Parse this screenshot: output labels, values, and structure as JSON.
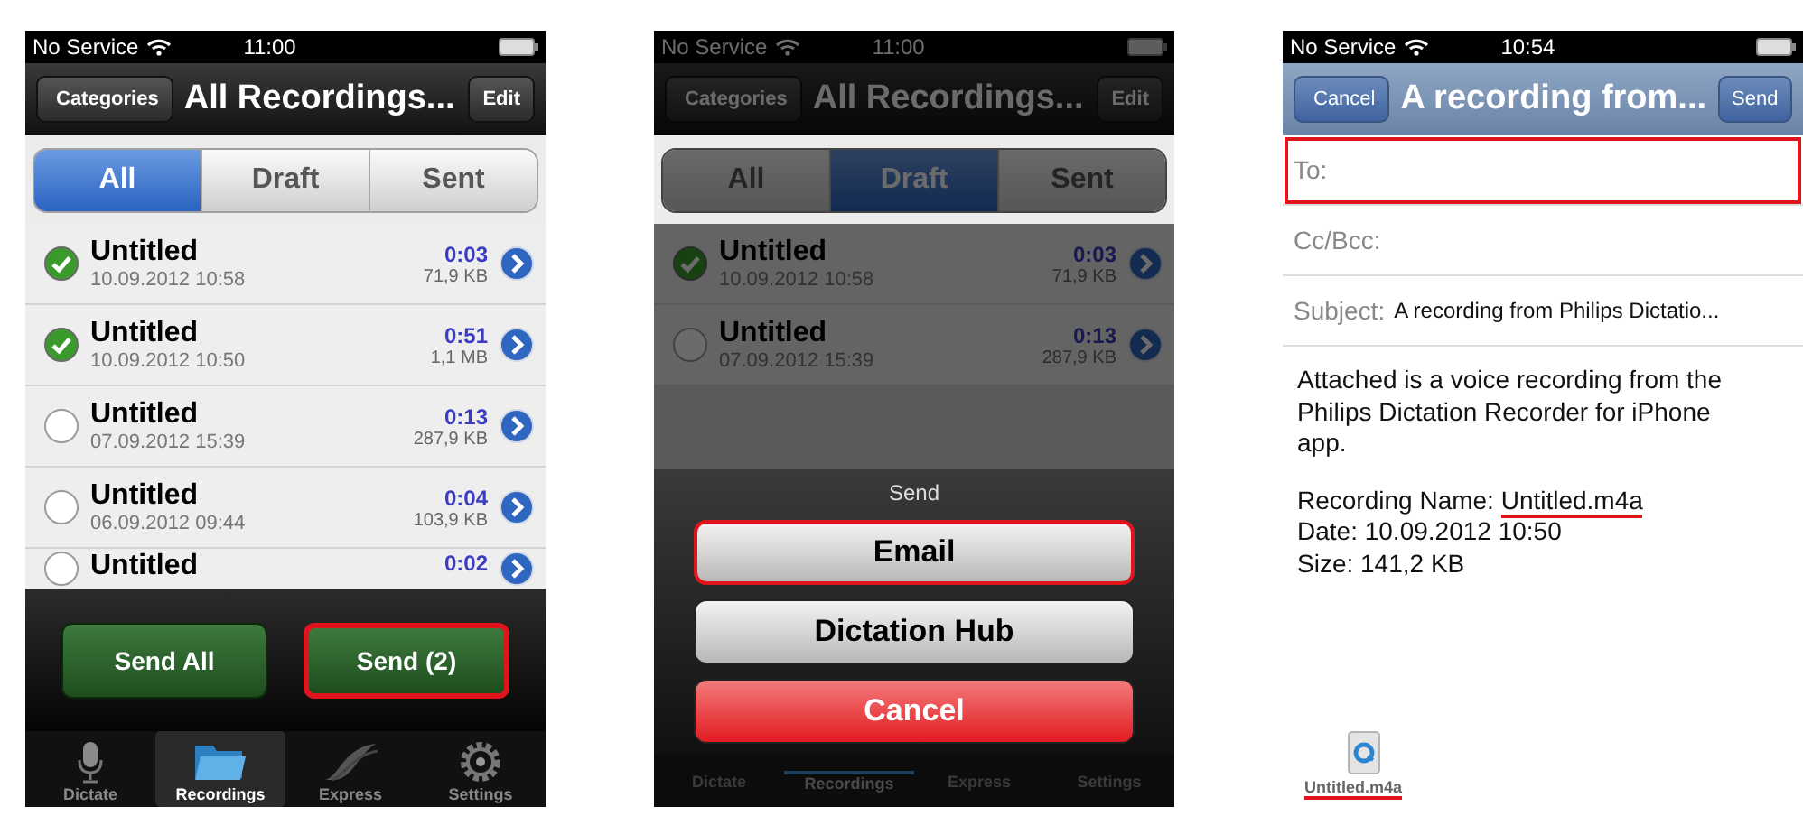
{
  "screens": [
    {
      "kind": "list",
      "dimmed": false,
      "status": {
        "carrier": "No Service",
        "time": "11:00"
      },
      "nav": {
        "back": "Categories",
        "title": "All Recordings...",
        "action": "Edit"
      },
      "segments": [
        {
          "label": "All",
          "selected": true
        },
        {
          "label": "Draft",
          "selected": false
        },
        {
          "label": "Sent",
          "selected": false
        }
      ],
      "rows": [
        {
          "name": "Untitled",
          "date": "10.09.2012 10:58",
          "duration": "0:03",
          "size": "71,9 KB",
          "checked": true
        },
        {
          "name": "Untitled",
          "date": "10.09.2012 10:50",
          "duration": "0:51",
          "size": "1,1 MB",
          "checked": true
        },
        {
          "name": "Untitled",
          "date": "07.09.2012 15:39",
          "duration": "0:13",
          "size": "287,9 KB",
          "checked": false
        },
        {
          "name": "Untitled",
          "date": "06.09.2012 09:44",
          "duration": "0:04",
          "size": "103,9 KB",
          "checked": false
        },
        {
          "name": "Untitled",
          "duration": "0:02",
          "checked": false
        }
      ],
      "toolbar": [
        {
          "label": "Send All",
          "highlighted": false
        },
        {
          "label": "Send (2)",
          "highlighted": true
        }
      ],
      "tabs": [
        {
          "label": "Dictate",
          "selected": false
        },
        {
          "label": "Recordings",
          "selected": true
        },
        {
          "label": "Express",
          "selected": false
        },
        {
          "label": "Settings",
          "selected": false
        }
      ]
    },
    {
      "kind": "list",
      "dimmed": true,
      "status": {
        "carrier": "No Service",
        "time": "11:00"
      },
      "nav": {
        "back": "Categories",
        "title": "All Recordings...",
        "action": "Edit"
      },
      "segments": [
        {
          "label": "All",
          "selected": false
        },
        {
          "label": "Draft",
          "selected": true
        },
        {
          "label": "Sent",
          "selected": false
        }
      ],
      "rows": [
        {
          "name": "Untitled",
          "date": "10.09.2012 10:58",
          "duration": "0:03",
          "size": "71,9 KB",
          "checked": true
        },
        {
          "name": "Untitled",
          "date": "07.09.2012 15:39",
          "duration": "0:13",
          "size": "287,9 KB",
          "checked": false
        }
      ],
      "sheet": {
        "title": "Send",
        "buttons": [
          {
            "label": "Email",
            "kind": "default",
            "highlighted": true
          },
          {
            "label": "Dictation Hub",
            "kind": "default",
            "highlighted": false
          },
          {
            "label": "Cancel",
            "kind": "destructive",
            "highlighted": false
          }
        ]
      },
      "tabs": [
        {
          "label": "Dictate",
          "selected": false
        },
        {
          "label": "Recordings",
          "selected": true
        },
        {
          "label": "Express",
          "selected": false
        },
        {
          "label": "Settings",
          "selected": false
        }
      ]
    },
    {
      "kind": "mail",
      "status": {
        "carrier": "No Service",
        "time": "10:54"
      },
      "nav": {
        "back": "Cancel",
        "title": "A recording from...",
        "action": "Send"
      },
      "fields": [
        {
          "label": "To:",
          "highlighted": true
        },
        {
          "label": "Cc/Bcc:",
          "highlighted": false
        },
        {
          "label": "Subject:",
          "value": "A recording from Philips Dictatio...",
          "highlighted": false
        }
      ],
      "body": "Attached is a voice recording from the Philips Dictation Recorder for iPhone app.",
      "details": [
        {
          "label": "Recording Name:",
          "value": "Untitled.m4a",
          "underlined": true
        },
        {
          "label": "Date:",
          "value": "10.09.2012 10:50",
          "underlined": false
        },
        {
          "label": "Size:",
          "value": "141,2 KB",
          "underlined": false
        }
      ],
      "attachment": {
        "name": "Untitled.m4a",
        "underlined": true
      }
    }
  ]
}
